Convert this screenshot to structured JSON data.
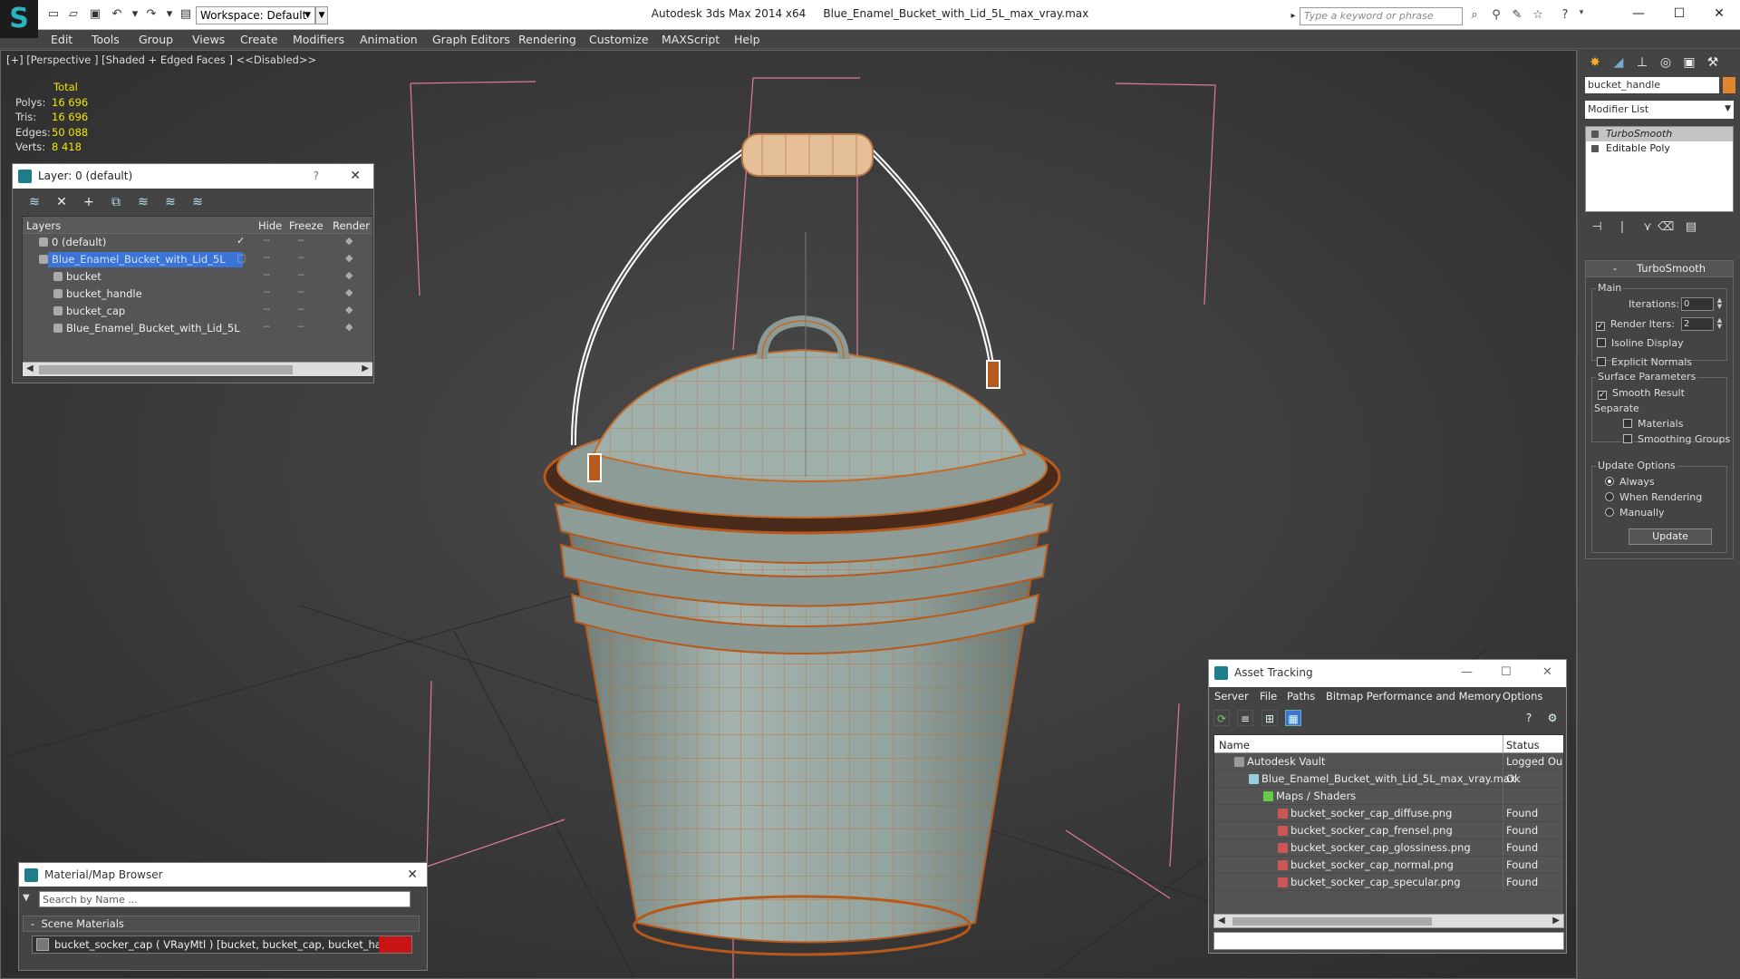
{
  "titlebar": {
    "app_title": "Autodesk 3ds Max  2014 x64",
    "file_title": "Blue_Enamel_Bucket_with_Lid_5L_max_vray.max",
    "workspace": "Workspace: Default",
    "search_placeholder": "Type a keyword or phrase"
  },
  "menu": [
    "Edit",
    "Tools",
    "Group",
    "Views",
    "Create",
    "Modifiers",
    "Animation",
    "Graph Editors",
    "Rendering",
    "Customize",
    "MAXScript",
    "Help"
  ],
  "viewport": {
    "label": "[+] [Perspective ] [Shaded + Edged Faces ]  <<Disabled>>",
    "stats": {
      "header": "Total",
      "polys_label": "Polys:",
      "polys": "16 696",
      "tris_label": "Tris:",
      "tris": "16 696",
      "edges_label": "Edges:",
      "edges": "50 088",
      "verts_label": "Verts:",
      "verts": "8 418"
    }
  },
  "layer_panel": {
    "title": "Layer: 0 (default)",
    "help": "?",
    "columns": {
      "layers": "Layers",
      "hide": "Hide",
      "freeze": "Freeze",
      "render": "Render"
    },
    "rows": [
      {
        "name": "0 (default)"
      },
      {
        "name": "Blue_Enamel_Bucket_with_Lid_5L"
      },
      {
        "name": "bucket"
      },
      {
        "name": "bucket_handle"
      },
      {
        "name": "bucket_cap"
      },
      {
        "name": "Blue_Enamel_Bucket_with_Lid_5L"
      }
    ]
  },
  "material_browser": {
    "title": "Material/Map Browser",
    "search_placeholder": "Search by Name ...",
    "group": "Scene Materials",
    "item": "bucket_socker_cap  ( VRayMtl ) [bucket, bucket_cap, bucket_handle]"
  },
  "command_panel": {
    "object_name": "bucket_handle",
    "object_color": "#e0862c",
    "modifier_list": "Modifier List",
    "stack": [
      "TurboSmooth",
      "Editable Poly"
    ],
    "rollout_title": "TurboSmooth",
    "main_group": "Main",
    "iterations_label": "Iterations:",
    "iterations": "0",
    "render_iters_label": "Render Iters:",
    "render_iters": "2",
    "isoline": "Isoline Display",
    "explicit_normals": "Explicit Normals",
    "surface_params": "Surface Parameters",
    "smooth_result": "Smooth Result",
    "separate": "Separate",
    "materials": "Materials",
    "smoothing_groups": "Smoothing Groups",
    "update_options": "Update Options",
    "always": "Always",
    "when_rendering": "When Rendering",
    "manually": "Manually",
    "update_button": "Update"
  },
  "asset_tracking": {
    "title": "Asset Tracking",
    "menu": [
      "Server",
      "File",
      "Paths",
      "Bitmap Performance and Memory",
      "Options"
    ],
    "columns": {
      "name": "Name",
      "status": "Status"
    },
    "rows": [
      {
        "name": "Autodesk Vault",
        "status": "Logged Ou"
      },
      {
        "name": "Blue_Enamel_Bucket_with_Lid_5L_max_vray.max",
        "status": "Ok"
      },
      {
        "name": "Maps / Shaders",
        "status": ""
      },
      {
        "name": "bucket_socker_cap_diffuse.png",
        "status": "Found"
      },
      {
        "name": "bucket_socker_cap_frensel.png",
        "status": "Found"
      },
      {
        "name": "bucket_socker_cap_glossiness.png",
        "status": "Found"
      },
      {
        "name": "bucket_socker_cap_normal.png",
        "status": "Found"
      },
      {
        "name": "bucket_socker_cap_specular.png",
        "status": "Found"
      }
    ]
  }
}
